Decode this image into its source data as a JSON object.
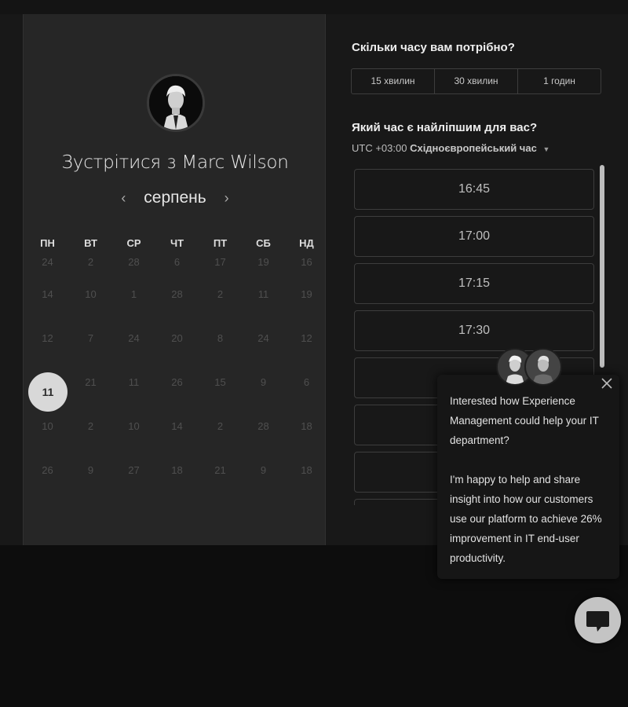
{
  "booking": {
    "title": "Зустрітися з Marc Wilson",
    "month": "серпень",
    "prev_arrow": "‹",
    "next_arrow": "›",
    "weekdays": [
      "ПН",
      "ВТ",
      "СР",
      "ЧТ",
      "ПТ",
      "СБ",
      "НД"
    ],
    "weeks": [
      [
        "24",
        "2",
        "28",
        "6",
        "17",
        "19",
        "16"
      ],
      [
        "14",
        "10",
        "1",
        "28",
        "2",
        "11",
        "19"
      ],
      [
        "12",
        "7",
        "24",
        "20",
        "8",
        "24",
        "12"
      ],
      [
        "11",
        "21",
        "11",
        "26",
        "15",
        "9",
        "6"
      ],
      [
        "10",
        "2",
        "10",
        "14",
        "2",
        "28",
        "18"
      ],
      [
        "26",
        "9",
        "27",
        "18",
        "21",
        "9",
        "18"
      ]
    ],
    "selected_day": "11"
  },
  "duration": {
    "question": "Скільки часу вам потрібно?",
    "options": [
      "15 хвилин",
      "30 хвилин",
      "1 годин"
    ]
  },
  "time": {
    "question": "Який час є найліпшим для вас?",
    "timezone_offset": "UTC +03:00",
    "timezone_name": "Східноєвропейський час",
    "slots": [
      "16:45",
      "17:00",
      "17:15",
      "17:30",
      "",
      "",
      "",
      ""
    ]
  },
  "chat": {
    "message_1": "Interested how Experience Management could help your IT department?",
    "message_2": "I'm happy to help and share insight into how our customers use our platform to achieve 26% improvement in IT end-user productivity."
  },
  "icons": {
    "close": "close-icon",
    "chat": "chat-bubble-icon",
    "caret": "caret-down-icon"
  }
}
